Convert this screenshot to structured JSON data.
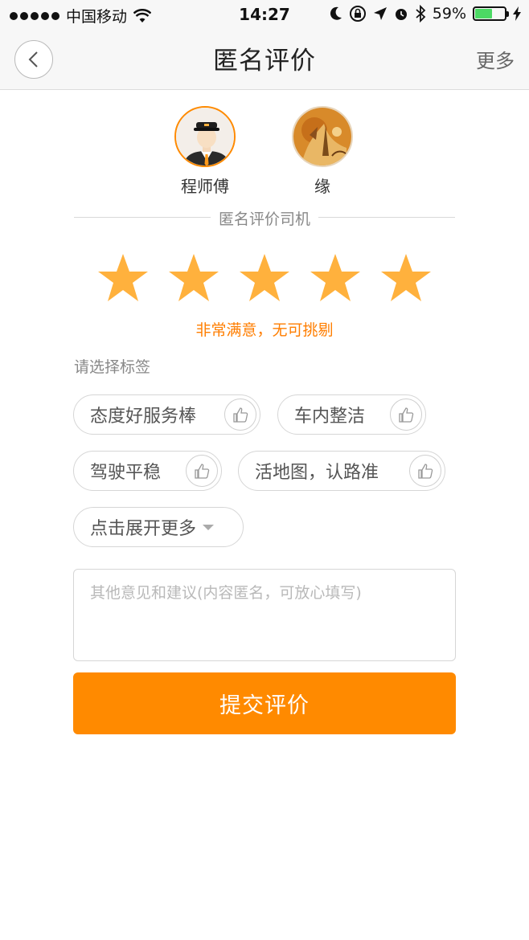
{
  "status_bar": {
    "carrier": "中国移动",
    "time": "14:27",
    "battery": "59%",
    "battery_level": 0.59,
    "icons": [
      "signal-dots",
      "wifi-icon",
      "moon-icon",
      "rotation-lock-icon",
      "location-arrow-icon",
      "alarm-icon",
      "bluetooth-icon",
      "battery-icon",
      "charging-bolt-icon"
    ]
  },
  "nav": {
    "back_icon": "chevron-left-icon",
    "title": "匿名评价",
    "more": "更多"
  },
  "avatars": [
    {
      "name": "程师傅",
      "icon": "driver-avatar"
    },
    {
      "name": "缘",
      "icon": "passenger-avatar"
    }
  ],
  "divider_text": "匿名评价司机",
  "rating": {
    "value": 5,
    "max": 5,
    "star_color": "#ffb13d",
    "text": "非常满意，无可挑剔"
  },
  "tags_label": "请选择标签",
  "tags": [
    {
      "label": "态度好服务棒",
      "icon": "thumbs-up-icon"
    },
    {
      "label": "车内整洁",
      "icon": "thumbs-up-icon"
    },
    {
      "label": "驾驶平稳",
      "icon": "thumbs-up-icon"
    },
    {
      "label": "活地图，认路准",
      "icon": "thumbs-up-icon"
    }
  ],
  "expand_more": "点击展开更多",
  "comment": {
    "placeholder": "其他意见和建议(内容匿名，可放心填写)",
    "value": ""
  },
  "submit_label": "提交评价",
  "colors": {
    "accent": "#ff8a00",
    "rating_text": "#ff7e00",
    "nav_bg": "#f7f7f7"
  }
}
